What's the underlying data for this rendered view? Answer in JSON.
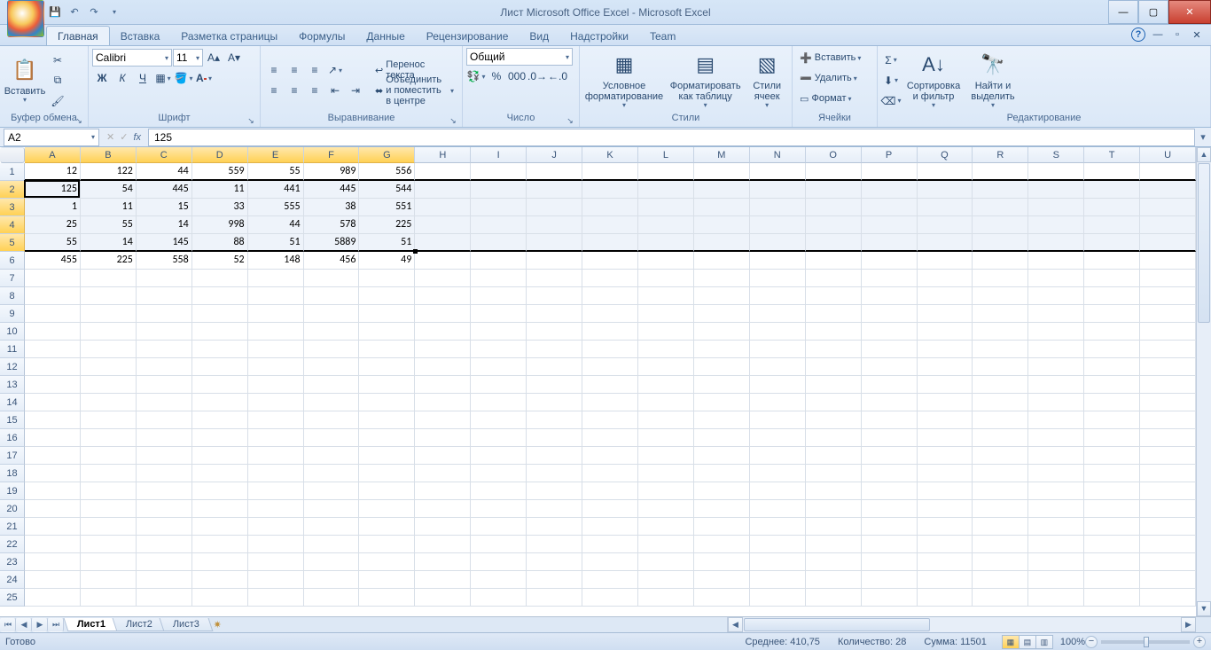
{
  "title": "Лист Microsoft Office Excel - Microsoft Excel",
  "tabs": [
    "Главная",
    "Вставка",
    "Разметка страницы",
    "Формулы",
    "Данные",
    "Рецензирование",
    "Вид",
    "Надстройки",
    "Team"
  ],
  "active_tab": 0,
  "ribbon": {
    "clipboard": {
      "paste": "Вставить",
      "title": "Буфер обмена"
    },
    "font": {
      "name": "Calibri",
      "size": "11",
      "title": "Шрифт",
      "bold": "Ж",
      "italic": "К",
      "underline": "Ч"
    },
    "alignment": {
      "wrap": "Перенос текста",
      "merge": "Объединить и поместить в центре",
      "title": "Выравнивание"
    },
    "number": {
      "format": "Общий",
      "title": "Число"
    },
    "styles": {
      "conditional": "Условное\nформатирование",
      "as_table": "Форматировать\nкак таблицу",
      "cell_styles": "Стили\nячеек",
      "title": "Стили"
    },
    "cells": {
      "insert": "Вставить",
      "delete": "Удалить",
      "format": "Формат",
      "title": "Ячейки"
    },
    "editing": {
      "sort": "Сортировка\nи фильтр",
      "find": "Найти и\nвыделить",
      "title": "Редактирование"
    }
  },
  "formula_bar": {
    "name_box": "A2",
    "fx": "fx",
    "value": "125"
  },
  "columns": [
    "A",
    "B",
    "C",
    "D",
    "E",
    "F",
    "G",
    "H",
    "I",
    "J",
    "K",
    "L",
    "M",
    "N",
    "O",
    "P",
    "Q",
    "R",
    "S",
    "T",
    "U"
  ],
  "row_count": 25,
  "selected_cols": [
    "A",
    "B",
    "C",
    "D",
    "E",
    "F",
    "G"
  ],
  "selected_rows": [
    2,
    3,
    4,
    5
  ],
  "active_cell": {
    "row": 2,
    "col": 0
  },
  "grid": [
    [
      12,
      122,
      44,
      559,
      55,
      989,
      556
    ],
    [
      125,
      54,
      445,
      11,
      441,
      445,
      544
    ],
    [
      1,
      11,
      15,
      33,
      555,
      38,
      551
    ],
    [
      25,
      55,
      14,
      998,
      44,
      578,
      225
    ],
    [
      55,
      14,
      145,
      88,
      51,
      5889,
      51
    ],
    [
      455,
      225,
      558,
      52,
      148,
      456,
      49
    ]
  ],
  "sheets": [
    "Лист1",
    "Лист2",
    "Лист3"
  ],
  "active_sheet": 0,
  "status": {
    "ready": "Готово",
    "avg_label": "Среднее:",
    "avg": "410,75",
    "count_label": "Количество:",
    "count": "28",
    "sum_label": "Сумма:",
    "sum": "11501",
    "zoom": "100%"
  }
}
